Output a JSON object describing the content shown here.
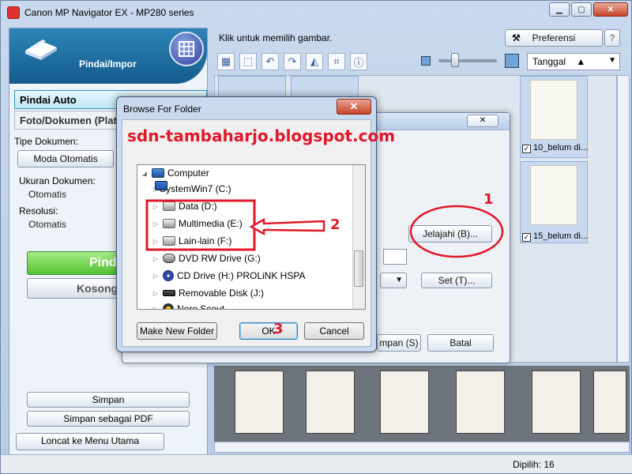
{
  "window": {
    "title": "Canon MP Navigator EX - MP280 series",
    "min": "▁",
    "max": "▢",
    "close": "✕"
  },
  "left": {
    "header_label": "Pindai/Impor",
    "mode_auto": "Pindai Auto",
    "mode_doc": "Foto/Dokumen (Plate",
    "doc_type_label": "Tipe Dokumen:",
    "doc_type_value": "Moda Otomatis",
    "doc_size_label": "Ukuran Dokumen:",
    "doc_size_value": "Otomatis",
    "resolution_label": "Resolusi:",
    "resolution_value": "Otomatis",
    "scan_button": "Pind",
    "clear_button": "Kosong",
    "save_button": "Simpan",
    "save_pdf_button": "Simpan sebagai PDF",
    "main_menu_button": "Loncat ke Menu Utama"
  },
  "right": {
    "hint": "Klik untuk memilih gambar.",
    "preferences_button": "Preferensi",
    "help_button": "?",
    "sort_value": "Tanggal",
    "thumbs": [
      {
        "caption": "10_belum di...",
        "checked": "✓"
      },
      {
        "caption": "15_belum di...",
        "checked": "✓"
      }
    ]
  },
  "back_dialog": {
    "browse_button": "Jelajahi (B)...",
    "set_button": "Set (T)...",
    "save_button": "mpan (S)",
    "cancel_button": "Batal",
    "close": "✕"
  },
  "browse_dialog": {
    "title": "Browse For Folder",
    "close": "✕",
    "watermark": "sdn-tambaharjo.blogspot.com",
    "tree": [
      {
        "label": "Computer",
        "icon": "computer-icon"
      },
      {
        "label": "SystemWin7 (C:)",
        "icon": "windows-drive-icon"
      },
      {
        "label": "Data (D:)",
        "icon": "drive-icon"
      },
      {
        "label": "Multimedia (E:)",
        "icon": "drive-icon"
      },
      {
        "label": "Lain-lain (F:)",
        "icon": "drive-icon"
      },
      {
        "label": "DVD RW Drive (G:)",
        "icon": "dvd-drive-icon"
      },
      {
        "label": "CD Drive (H:) PROLiNK HSPA",
        "icon": "cd-drive-icon"
      },
      {
        "label": "Removable Disk (J:)",
        "icon": "removable-disk-icon"
      },
      {
        "label": "Nero Scout",
        "icon": "nero-icon"
      }
    ],
    "make_folder_button": "Make New Folder",
    "ok_button": "OK",
    "cancel_button": "Cancel"
  },
  "annotations": {
    "one": "1",
    "two": "2",
    "three": "3"
  },
  "status": {
    "selected": "Dipilih: 16"
  },
  "colors": {
    "annotation_red": "#e0182a",
    "accent_blue": "#1e6ea3",
    "scan_green": "#55c232"
  }
}
